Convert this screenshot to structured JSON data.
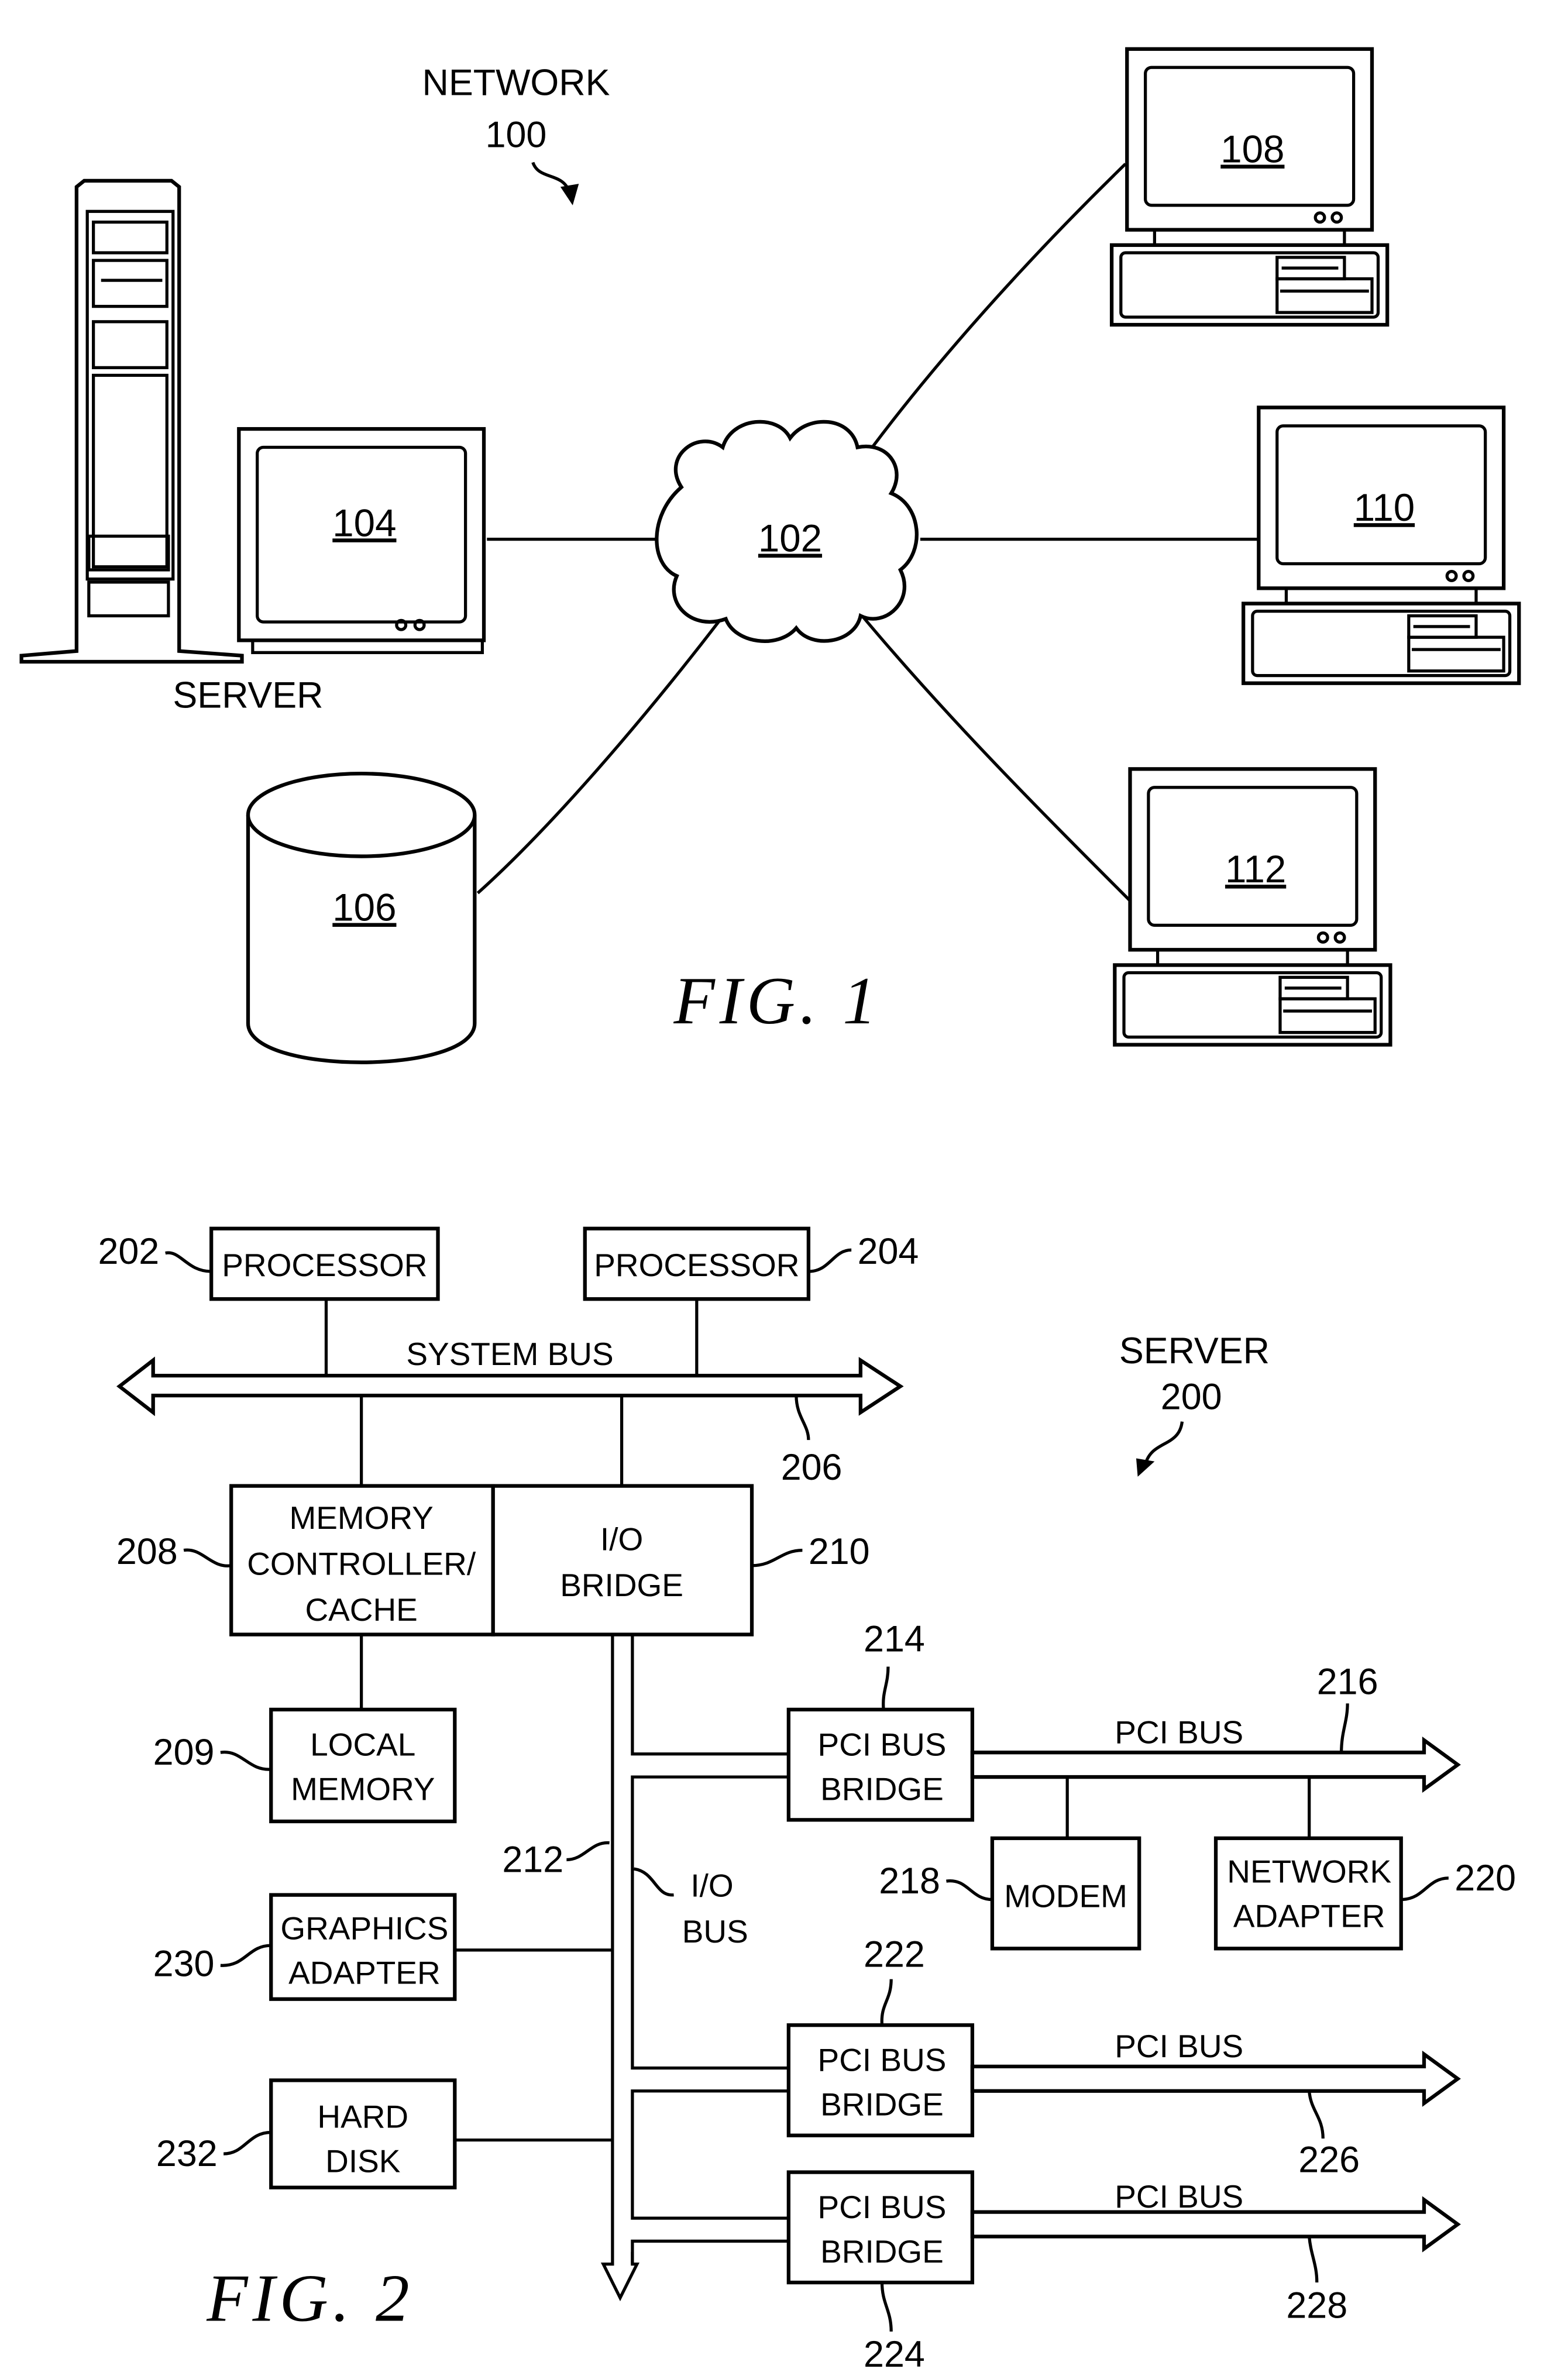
{
  "figure1": {
    "caption": "FIG. 1",
    "network_label": "NETWORK",
    "network_ref": "100",
    "server_label": "SERVER",
    "nodes": {
      "cloud": "102",
      "server_client": "104",
      "storage": "106",
      "client_a": "108",
      "client_b": "110",
      "client_c": "112"
    }
  },
  "figure2": {
    "caption": "FIG. 2",
    "server_label": "SERVER",
    "server_ref": "200",
    "processor_a": {
      "label": "PROCESSOR",
      "ref": "202"
    },
    "processor_b": {
      "label": "PROCESSOR",
      "ref": "204"
    },
    "system_bus": {
      "label": "SYSTEM BUS",
      "ref": "206"
    },
    "memory_controller": {
      "lines": [
        "MEMORY",
        "CONTROLLER/",
        "CACHE"
      ],
      "ref": "208"
    },
    "io_bridge": {
      "lines": [
        "I/O",
        "BRIDGE"
      ],
      "ref": "210"
    },
    "local_memory": {
      "lines": [
        "LOCAL",
        "MEMORY"
      ],
      "ref": "209"
    },
    "io_bus": {
      "lines": [
        "I/O",
        "BUS"
      ],
      "ref": "212"
    },
    "graphics_adapter": {
      "lines": [
        "GRAPHICS",
        "ADAPTER"
      ],
      "ref": "230"
    },
    "hard_disk": {
      "lines": [
        "HARD",
        "DISK"
      ],
      "ref": "232"
    },
    "pci_bridge_1": {
      "lines": [
        "PCI BUS",
        "BRIDGE"
      ],
      "ref": "214"
    },
    "pci_bridge_2": {
      "lines": [
        "PCI BUS",
        "BRIDGE"
      ],
      "ref": "222"
    },
    "pci_bridge_3": {
      "lines": [
        "PCI BUS",
        "BRIDGE"
      ],
      "ref": "224"
    },
    "pci_bus_1": {
      "label": "PCI BUS",
      "ref": "216"
    },
    "pci_bus_2": {
      "label": "PCI BUS",
      "ref": "226"
    },
    "pci_bus_3": {
      "label": "PCI BUS",
      "ref": "228"
    },
    "modem": {
      "label": "MODEM",
      "ref": "218"
    },
    "network_adapter": {
      "lines": [
        "NETWORK",
        "ADAPTER"
      ],
      "ref": "220"
    }
  }
}
